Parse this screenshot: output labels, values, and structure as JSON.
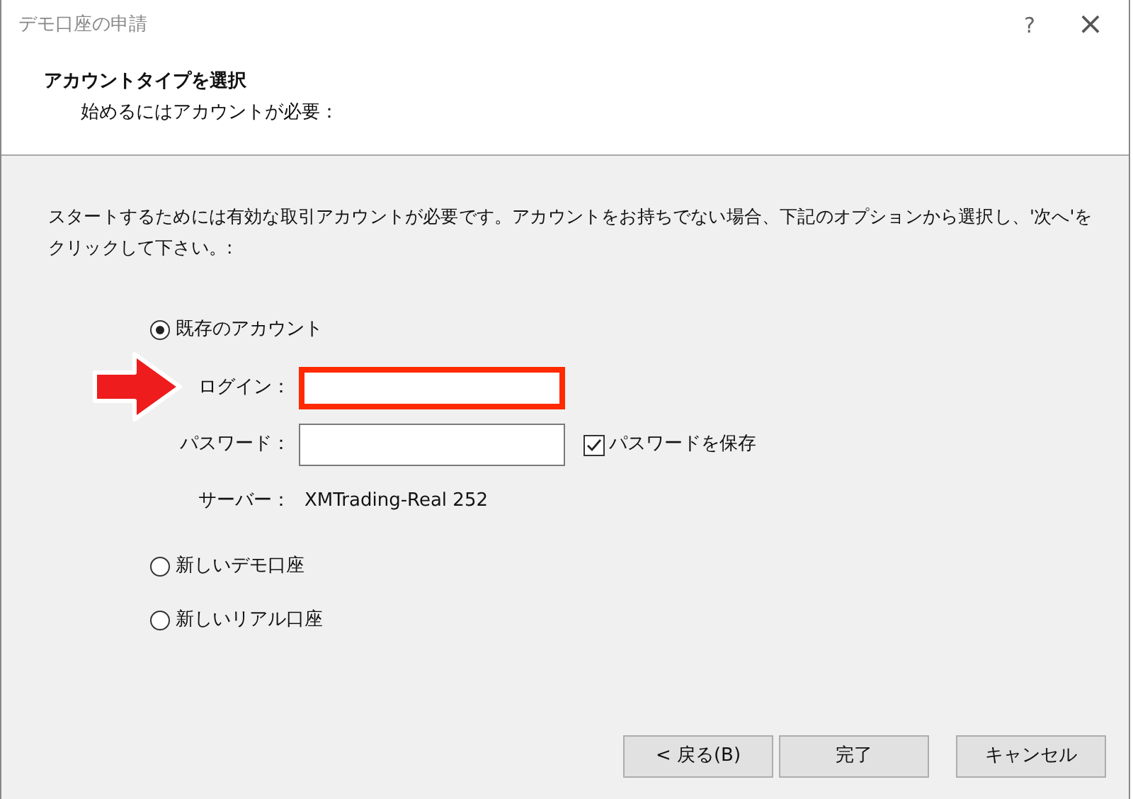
{
  "window": {
    "title": "デモ口座の申請",
    "help": "?",
    "close": "×"
  },
  "header": {
    "heading": "アカウントタイプを選択",
    "subheading": "始めるにはアカウントが必要："
  },
  "intro": "スタートするためには有効な取引アカウントが必要です。アカウントをお持ちでない場合、下記のオプションから選択し、'次へ'をクリックして下さい。:",
  "options": [
    {
      "label": "既存のアカウント",
      "selected": true
    },
    {
      "label": "新しいデモ口座",
      "selected": false
    },
    {
      "label": "新しいリアル口座",
      "selected": false
    }
  ],
  "login": {
    "label": "ログイン：",
    "highlighted": true
  },
  "password": {
    "label": "パスワード：",
    "save": {
      "label": "パスワードを保存",
      "checked": true
    }
  },
  "server": {
    "label": "サーバー：",
    "value": "XMTrading-Real 252"
  },
  "buttons": [
    {
      "label": "< 戻る(B)"
    },
    {
      "label": "完了"
    },
    {
      "label": "キャンセル"
    }
  ]
}
